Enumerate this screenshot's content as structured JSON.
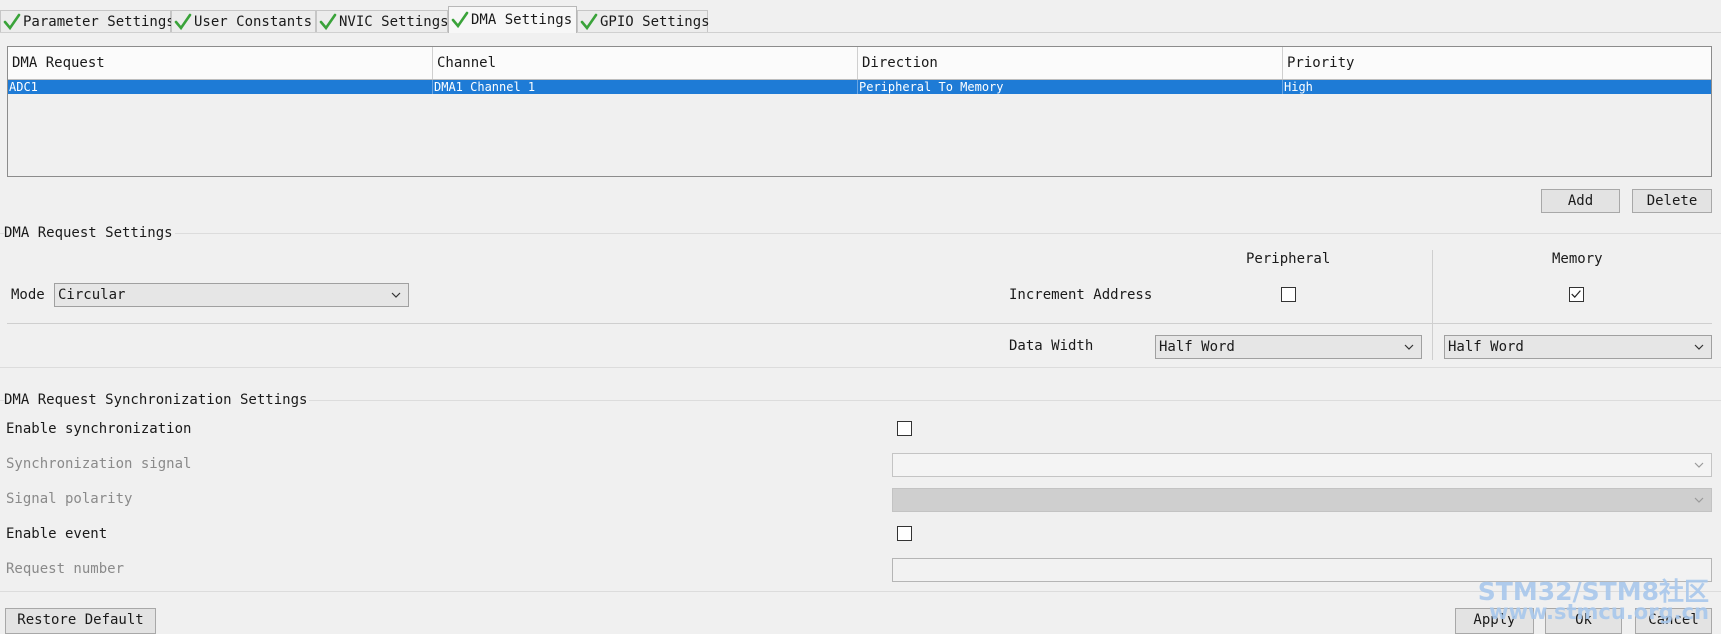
{
  "tabs": [
    {
      "label": "Parameter Settings",
      "icon": "checkmark-icon"
    },
    {
      "label": "User Constants",
      "icon": "checkmark-icon"
    },
    {
      "label": "NVIC Settings",
      "icon": "checkmark-icon"
    },
    {
      "label": "DMA Settings",
      "icon": "checkmark-icon",
      "active": true
    },
    {
      "label": "GPIO Settings",
      "icon": "checkmark-icon"
    }
  ],
  "dma_table": {
    "columns": [
      "DMA Request",
      "Channel",
      "Direction",
      "Priority"
    ],
    "rows": [
      {
        "request": "ADC1",
        "channel": "DMA1 Channel 1",
        "direction": "Peripheral To Memory",
        "priority": "High",
        "selected": true
      }
    ]
  },
  "table_buttons": {
    "add": "Add",
    "delete": "Delete"
  },
  "request_settings": {
    "title": "DMA Request Settings",
    "mode_label": "Mode",
    "mode_value": "Circular",
    "peripheral_header": "Peripheral",
    "memory_header": "Memory",
    "increment_label": "Increment Address",
    "peripheral_increment": false,
    "memory_increment": true,
    "data_width_label": "Data Width",
    "peripheral_width": "Half Word",
    "memory_width": "Half Word"
  },
  "sync_settings": {
    "title": "DMA Request Synchronization Settings",
    "enable_sync_label": "Enable synchronization",
    "sync_signal_label": "Synchronization signal",
    "signal_polarity_label": "Signal polarity",
    "enable_event_label": "Enable event",
    "request_number_label": "Request number",
    "enable_sync": false,
    "enable_event": false
  },
  "footer": {
    "restore_default": "Restore Default",
    "apply": "Apply",
    "ok": "Ok",
    "cancel": "Cancel"
  },
  "watermark": {
    "line1": "STM32/STM8社区",
    "line2": "www.stmcu.org.cn"
  },
  "colors": {
    "selection": "#1e7bd6",
    "check_green": "#3aa33a"
  }
}
